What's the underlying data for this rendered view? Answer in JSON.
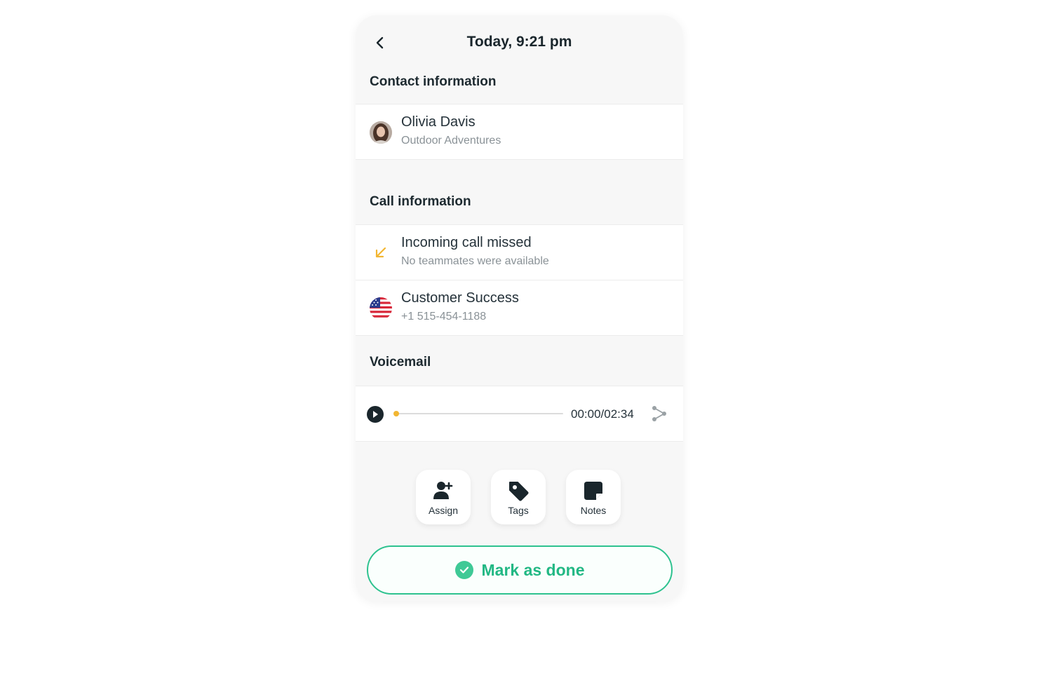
{
  "header": {
    "title": "Today, 9:21 pm",
    "back_icon": "chevron-left-icon"
  },
  "contact": {
    "section_title": "Contact information",
    "name": "Olivia Davis",
    "company": "Outdoor Adventures"
  },
  "call": {
    "section_title": "Call information",
    "status": "Incoming call missed",
    "status_detail": "No teammates were available",
    "status_icon": "missed-call-arrow-icon",
    "status_color": "#f2b632",
    "line_name": "Customer Success",
    "line_number": "+1 515-454-1188",
    "line_icon": "us-flag-icon"
  },
  "voicemail": {
    "section_title": "Voicemail",
    "time": "00:00/02:34",
    "progress": 0.0,
    "accent": "#f2b632"
  },
  "actions": [
    {
      "label": "Assign",
      "icon": "assign-user-icon"
    },
    {
      "label": "Tags",
      "icon": "tag-icon"
    },
    {
      "label": "Notes",
      "icon": "note-icon"
    }
  ],
  "done": {
    "label": "Mark as done",
    "color": "#22b884"
  }
}
